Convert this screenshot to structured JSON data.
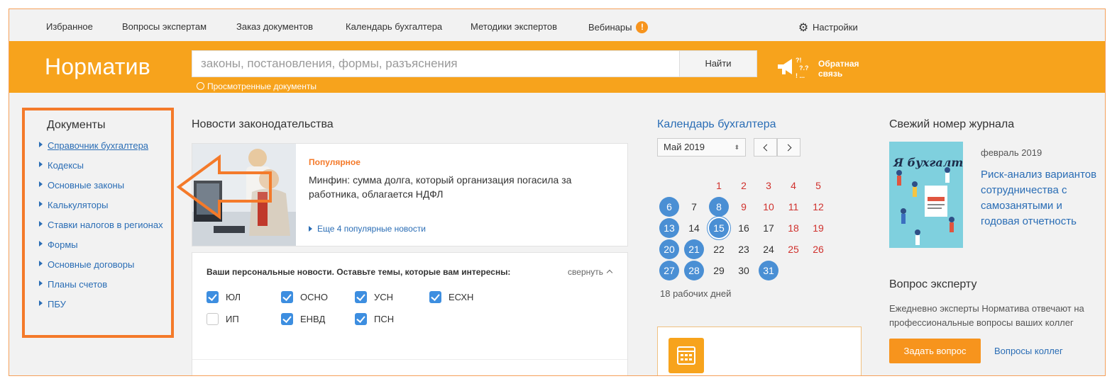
{
  "topnav": {
    "items": [
      "Избранное",
      "Вопросы экспертам",
      "Заказ  документов",
      "Календарь бухгалтера",
      "Методики экспертов",
      "Вебинары"
    ],
    "webinar_badge": "!",
    "settings_label": "Настройки"
  },
  "header": {
    "logo": "Норматив",
    "search_placeholder": "законы, постановления, формы, разъяснения",
    "search_button": "Найти",
    "viewed_docs": "Просмотренные документы",
    "feedback_line1": "Обратная",
    "feedback_line2": "связь"
  },
  "sidebar": {
    "title": "Документы",
    "items": [
      "Справочник бухгалтера",
      "Кодексы",
      "Основные законы",
      "Калькуляторы",
      "Ставки налогов в регионах",
      "Формы",
      "Основные договоры",
      "Планы счетов",
      "ПБУ"
    ]
  },
  "news": {
    "title": "Новости законодательства",
    "tag": "Популярное",
    "headline": "Минфин: сумма долга, который организация погасила за работника, облагается НДФЛ",
    "more": "Еще 4 популярные новости"
  },
  "personal": {
    "title": "Ваши персональные новости. Оставьте темы, которые вам интересны:",
    "collapse": "свернуть",
    "options": [
      {
        "label": "ЮЛ",
        "checked": true
      },
      {
        "label": "ОСНО",
        "checked": true
      },
      {
        "label": "УСН",
        "checked": true
      },
      {
        "label": "ЕСХН",
        "checked": true
      },
      {
        "label": "ИП",
        "checked": false
      },
      {
        "label": "ЕНВД",
        "checked": true
      },
      {
        "label": "ПСН",
        "checked": true
      }
    ]
  },
  "calendar": {
    "title": "Календарь бухгалтера",
    "month_select": "Май 2019",
    "days": [
      {
        "d": "1",
        "red": true
      },
      {
        "d": "2",
        "red": true
      },
      {
        "d": "3",
        "red": true
      },
      {
        "d": "4",
        "red": true
      },
      {
        "d": "5",
        "red": true
      },
      {
        "d": "6",
        "hl": true
      },
      {
        "d": "7"
      },
      {
        "d": "8",
        "hl": true
      },
      {
        "d": "9",
        "red": true
      },
      {
        "d": "10",
        "red": true
      },
      {
        "d": "11",
        "red": true
      },
      {
        "d": "12",
        "red": true
      },
      {
        "d": "13",
        "hl": true
      },
      {
        "d": "14"
      },
      {
        "d": "15",
        "today": true
      },
      {
        "d": "16"
      },
      {
        "d": "17"
      },
      {
        "d": "18",
        "red": true
      },
      {
        "d": "19",
        "red": true
      },
      {
        "d": "20",
        "hl": true
      },
      {
        "d": "21",
        "hl": true
      },
      {
        "d": "22"
      },
      {
        "d": "23"
      },
      {
        "d": "24"
      },
      {
        "d": "25",
        "red": true
      },
      {
        "d": "26",
        "red": true
      },
      {
        "d": "27",
        "hl": true
      },
      {
        "d": "28",
        "hl": true
      },
      {
        "d": "29"
      },
      {
        "d": "30"
      },
      {
        "d": "31",
        "hl": true
      }
    ],
    "first_weekday_index": 2,
    "workdays": "18 рабочих дней"
  },
  "journal": {
    "title": "Свежий номер журнала",
    "cover_title": "Я бухгалтер",
    "date": "февраль 2019",
    "headline": "Риск-анализ вариантов сотрудничества с самозанятыми и годовая отчетность"
  },
  "expert": {
    "title": "Вопрос эксперту",
    "text": "Ежедневно эксперты Норматива отвечают на профессиональные вопросы ваших коллег",
    "ask_button": "Задать вопрос",
    "colleagues_link": "Вопросы коллег"
  },
  "colors": {
    "brand_orange": "#f7a31c",
    "highlight_outline": "#f47a2a",
    "link_blue": "#2a6db5",
    "holiday_red": "#d0312d",
    "calendar_blue": "#4a8fd4"
  }
}
